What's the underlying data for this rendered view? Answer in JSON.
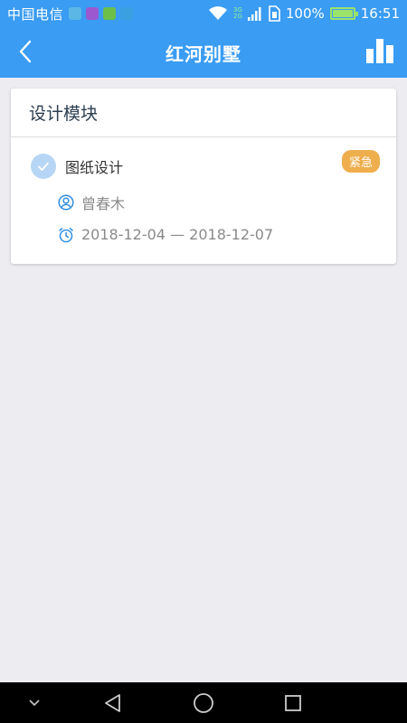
{
  "status_bar": {
    "carrier": "中国电信",
    "battery": "100%",
    "time": "16:51",
    "net_top": "3G",
    "net_bottom": "2G"
  },
  "header": {
    "title": "红河别墅",
    "back_icon": "chevron-left-icon",
    "stats_icon": "bar-chart-icon"
  },
  "module": {
    "title": "设计模块",
    "task": {
      "title": "图纸设计",
      "badge": "紧急",
      "assignee": "曾春木",
      "date_range": "2018-12-04 — 2018-12-07"
    }
  },
  "colors": {
    "primary": "#3a9cf3",
    "badge": "#efae4d",
    "background": "#ececf1"
  }
}
